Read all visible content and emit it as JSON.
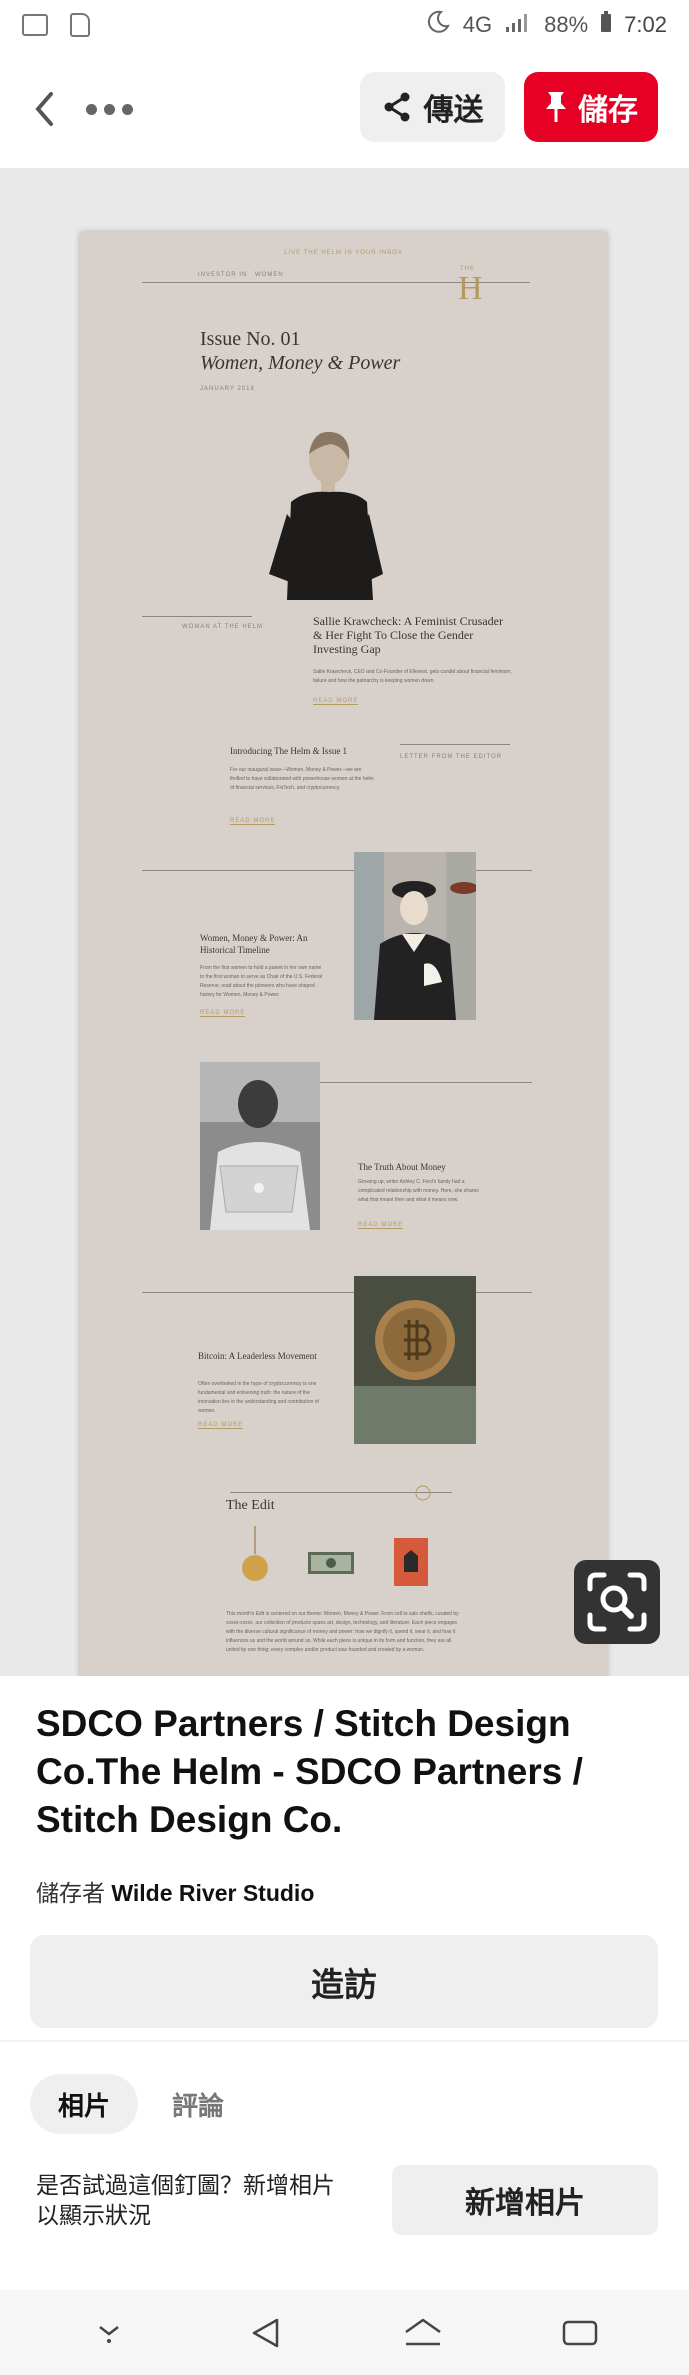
{
  "status_bar": {
    "network": "4G",
    "battery": "88%",
    "time": "7:02"
  },
  "toolbar": {
    "send_label": "傳送",
    "save_label": "儲存"
  },
  "preview": {
    "tagline": "LIVE THE HELM IN YOUR INBOX",
    "nav_left": "INVESTOR IN",
    "nav_right": "WOMEN",
    "logo_small": "THE",
    "logo_letter": "H",
    "issue_title": "Issue No. 01",
    "issue_subtitle": "Women, Money & Power",
    "issue_date": "JANUARY 2018",
    "feature_label": "WOMAN AT THE HELM",
    "feature_title": "Sallie Krawcheck: A Feminist Crusader & Her Fight To Close the Gender Investing Gap",
    "feature_body": "Sallie Krawcheck, CEO and Co-Founder of Ellevest, gets candid about financial feminism, failure and how the patriarchy is keeping women down.",
    "read_more": "READ MORE",
    "intro_title": "Introducing The Helm & Issue 1",
    "intro_label": "LETTER FROM THE EDITOR",
    "intro_body": "For our inaugural issue—Women, Money & Power—we are thrilled to have collaborated with powerhouse women at the helm of financial services, FinTech, and cryptocurrency.",
    "timeline_title": "Women, Money & Power: An Historical Timeline",
    "timeline_body": "From the first women to hold a patent in her own name to the first woman to serve as Chair of the U.S. Federal Reserve, read about the pioneers who have shaped history for Women, Money & Power.",
    "money_title": "The Truth About Money",
    "money_body": "Growing up, writer Ashley C. Ford's family had a complicated relationship with money. Here, she shares what that meant then and what it means now.",
    "bitcoin_title": "Bitcoin: A Leaderless Movement",
    "bitcoin_body": "Often overlooked in the hype of cryptocurrency is one fundamental and enlivening truth: the nature of the innovation lies in the understanding and contribution of women.",
    "edit_title": "The Edit",
    "edit_body": "This month's Edit is centered on our theme: Women, Money & Power. From cell to sale shelfs, curated by xxxxx-xxxxx, our collection of products spans art, design, technology, and literature. Each piece engages with the diverse cultural significance of money and power: how we dignify it, spend it, wear it, and how it influences us and the world around us. While each piece is unique in its form and function, they are all united by one thing: every complex and/or product was founded and created by a woman."
  },
  "pin": {
    "title": "SDCO Partners / Stitch Design Co.The Helm - SDCO Partners / Stitch Design Co.",
    "saved_by_prefix": "儲存者",
    "saved_by_name": "Wilde River Studio",
    "visit_label": "造訪"
  },
  "tabs": {
    "photos": "相片",
    "comments": "評論"
  },
  "prompt": {
    "text": "是否試過這個釘圖？新增相片以顯示狀況",
    "add_photo_label": "新增相片"
  },
  "icons": [
    "gallery-icon",
    "sd-card-icon",
    "alarm-icon",
    "signal-icon",
    "battery-icon",
    "back-icon",
    "more-icon",
    "share-icon",
    "pin-icon",
    "visual-search-icon",
    "nav-down-icon",
    "nav-back-icon",
    "nav-home-icon",
    "nav-recents-icon"
  ],
  "colors": {
    "save_red": "#e60023",
    "button_grey": "#efefef",
    "accent_gold": "#b49a60",
    "sheet_bg": "#d8d1cb"
  }
}
